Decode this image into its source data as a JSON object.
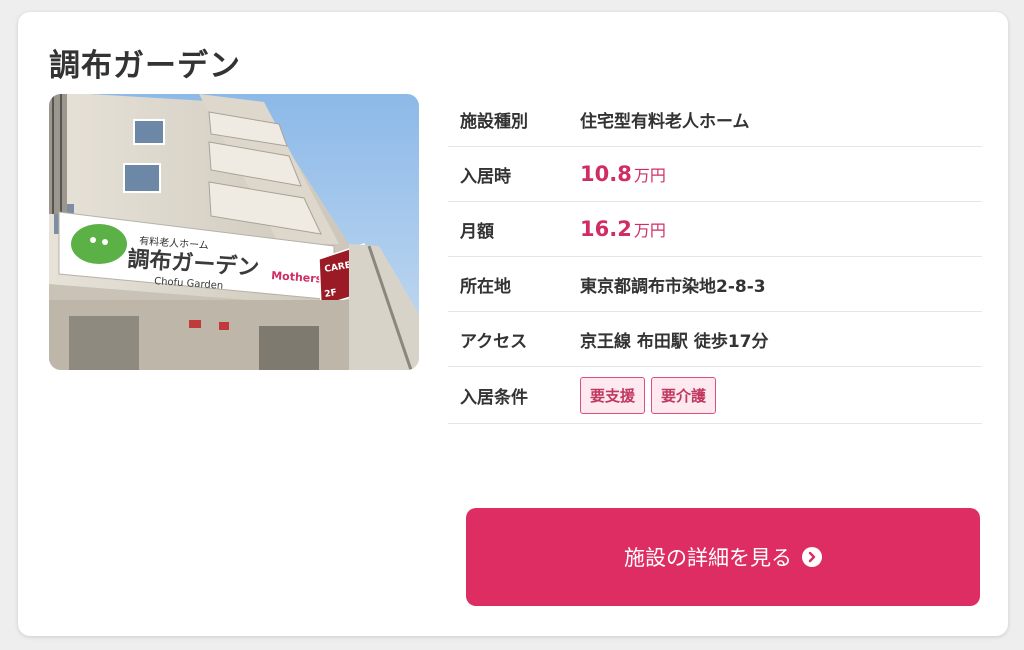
{
  "facility": {
    "name": "調布ガーデン",
    "photo_alt": "調布ガーデン 外観",
    "sign": {
      "small_text": "有料老人ホーム",
      "main_text": "調布ガーデン",
      "roman_text": "Chofu Garden",
      "brand": "Mothers",
      "cares": "CARES",
      "floor": "2F"
    }
  },
  "details": [
    {
      "label": "施設種別",
      "value": "住宅型有料老人ホーム"
    },
    {
      "label": "入居時",
      "price": "10.8",
      "unit": "万円"
    },
    {
      "label": "月額",
      "price": "16.2",
      "unit": "万円"
    },
    {
      "label": "所在地",
      "value": "東京都調布市染地2-8-3"
    },
    {
      "label": "アクセス",
      "value": "京王線 布田駅 徒歩17分"
    },
    {
      "label": "入居条件",
      "tags": [
        "要支援",
        "要介護"
      ]
    }
  ],
  "button": {
    "label": "施設の詳細を見る",
    "icon": "chevron-right-circle-icon"
  },
  "colors": {
    "accent": "#dd2d62",
    "price": "#d02d64",
    "tag_bg": "#fde9ef",
    "tag_border": "#d9507a"
  }
}
